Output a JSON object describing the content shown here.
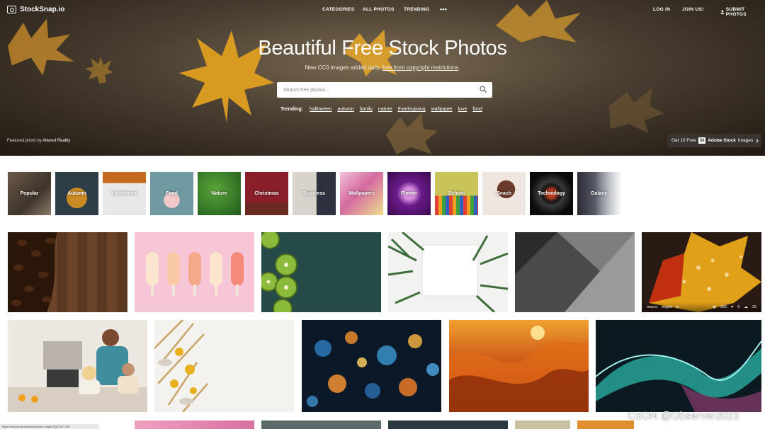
{
  "brand": {
    "logo": "StockSnap.io"
  },
  "nav": {
    "categories": "CATEGORIES",
    "all_photos": "ALL PHOTOS",
    "trending": "TRENDING",
    "more": "•••",
    "login": "LOG IN",
    "join": "JOIN US!",
    "submit": "SUBMIT PHOTOS"
  },
  "hero": {
    "title": "Beautiful Free Stock Photos",
    "subtitle_pre": "New CC0 images added daily, ",
    "subtitle_link": "free from copyright restrictions",
    "subtitle_post": ".",
    "search_placeholder": "Search free photos...",
    "trending_label": "Trending:",
    "trending_tags": [
      "halloween",
      "autumn",
      "family",
      "nature",
      "thanksgiving",
      "wallpaper",
      "love",
      "food"
    ],
    "credit_pre": "Featured photo by ",
    "credit_name": "Altered Reality",
    "adobe_pre": "Get 10 Free",
    "adobe_badge": "St",
    "adobe_brand": "Adobe Stock",
    "adobe_post": "Images"
  },
  "categories": [
    {
      "label": "Popular"
    },
    {
      "label": "Autumn"
    },
    {
      "label": "Halloween"
    },
    {
      "label": "Food"
    },
    {
      "label": "Nature"
    },
    {
      "label": "Christmas"
    },
    {
      "label": "Business"
    },
    {
      "label": "Wallpapers"
    },
    {
      "label": "Flower"
    },
    {
      "label": "School"
    },
    {
      "label": "Beach"
    },
    {
      "label": "Technology"
    },
    {
      "label": "Galaxy"
    }
  ],
  "photo_stats": {
    "tags": [
      "macro",
      "maple",
      "le"
    ],
    "views": "380",
    "likes": "0",
    "downloads": "25"
  },
  "status_url": "https://stocksnap.io/photo/leaves-maple-5QS1AC7MX",
  "watermark": "CSDN @Observer2023",
  "colors": {
    "accent": "#ffffff",
    "search_bg": "#ffffff",
    "adobe_bg": "#3c3732"
  }
}
